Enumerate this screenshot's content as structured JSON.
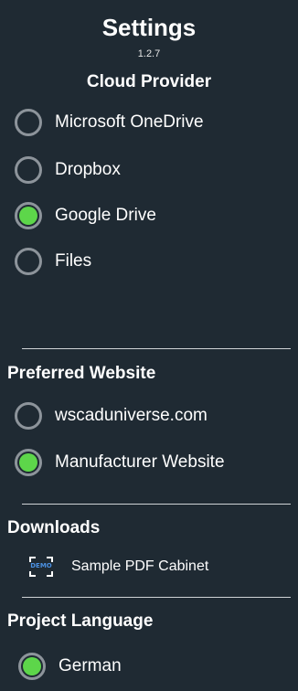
{
  "header": {
    "title": "Settings",
    "version": "1.2.7"
  },
  "cloud_provider": {
    "heading": "Cloud Provider",
    "options": [
      {
        "label": "Microsoft OneDrive",
        "selected": false
      },
      {
        "label": "Dropbox",
        "selected": false
      },
      {
        "label": "Google Drive",
        "selected": true
      },
      {
        "label": "Files",
        "selected": false
      }
    ]
  },
  "preferred_website": {
    "heading": "Preferred Website",
    "options": [
      {
        "label": "wscaduniverse.com",
        "selected": false
      },
      {
        "label": "Manufacturer Website",
        "selected": true
      }
    ]
  },
  "downloads": {
    "heading": "Downloads",
    "items": [
      {
        "label": "Sample PDF Cabinet",
        "icon": "demo-document-icon",
        "icon_text": "DEMO"
      }
    ]
  },
  "project_language": {
    "heading": "Project Language",
    "options": [
      {
        "label": "German",
        "selected": true
      }
    ]
  },
  "colors": {
    "background": "#1f2a33",
    "radio_ring": "#8d949b",
    "radio_selected": "#5dd64a",
    "demo_icon_text": "#4a90e2"
  }
}
